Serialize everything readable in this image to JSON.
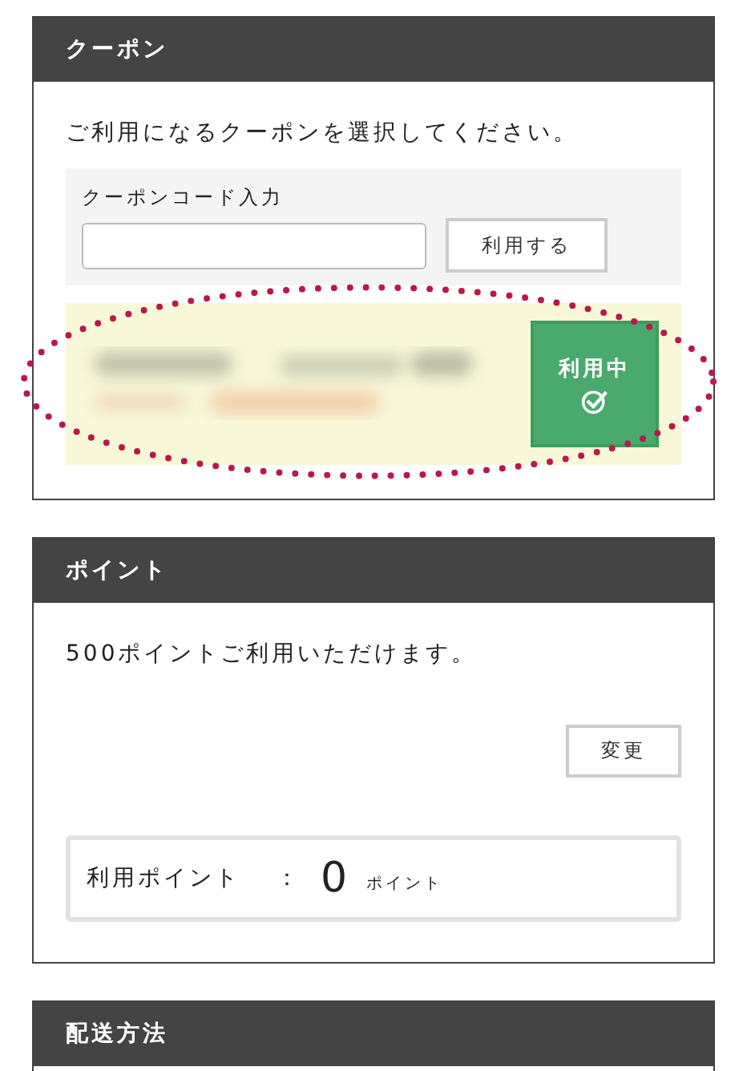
{
  "coupon": {
    "title": "クーポン",
    "instruction": "ご利用になるクーポンを選択してください。",
    "code_label": "クーポンコード入力",
    "apply_button": "利用する",
    "applied_coupon": {
      "in_use": true,
      "status": "利用中"
    }
  },
  "points": {
    "title": "ポイント",
    "available": "500ポイントご利用いただけます。",
    "change_button": "変更",
    "used_label": "利用ポイント",
    "separator": "：",
    "used_value": "0",
    "unit": "ポイント"
  },
  "shipping": {
    "title": "配送方法"
  }
}
